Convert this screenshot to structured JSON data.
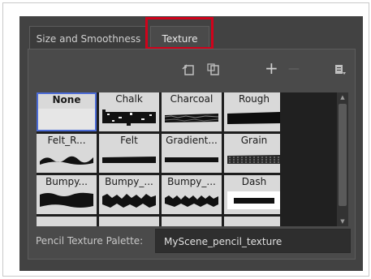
{
  "tabs": [
    {
      "label": "Size and Smoothness"
    },
    {
      "label": "Texture"
    }
  ],
  "toolbar": {
    "icons": [
      "import-texture-icon",
      "clone-texture-icon",
      "add-icon",
      "remove-icon",
      "menu-icon"
    ],
    "add_glyph": "+",
    "remove_glyph": "—"
  },
  "textures": [
    {
      "label": "None"
    },
    {
      "label": "Chalk"
    },
    {
      "label": "Charcoal"
    },
    {
      "label": "Rough"
    },
    {
      "label": "Felt_R..."
    },
    {
      "label": "Felt"
    },
    {
      "label": "Gradient..."
    },
    {
      "label": "Grain"
    },
    {
      "label": "Bumpy..."
    },
    {
      "label": "Bumpy_..."
    },
    {
      "label": "Bumpy_..."
    },
    {
      "label": "Dash"
    }
  ],
  "palette": {
    "label": "Pencil Texture Palette:",
    "value": "MyScene_pencil_texture"
  },
  "colors": {
    "panel_bg": "#424242",
    "highlight": "#d0021b",
    "selection": "#4b6bd6"
  }
}
